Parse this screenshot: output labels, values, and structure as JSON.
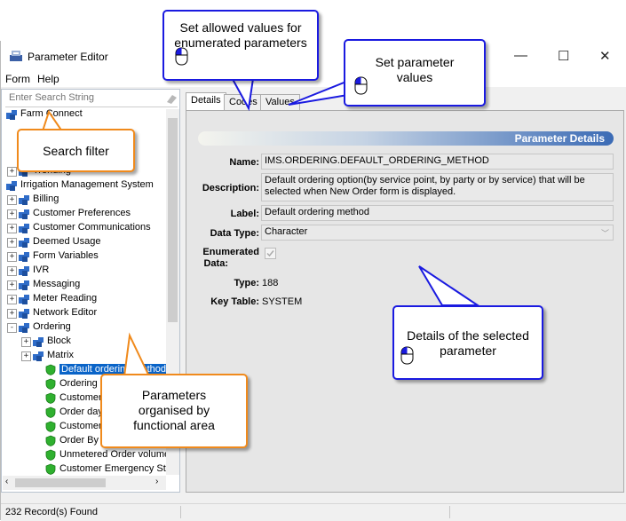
{
  "window": {
    "title": "Parameter Editor",
    "controls": {
      "minimize": "—",
      "maximize": "☐",
      "close": "✕"
    }
  },
  "menu": {
    "items": [
      "Form",
      "Help"
    ]
  },
  "search": {
    "placeholder": "Enter Search String"
  },
  "tree": {
    "root1": "Farm Connect",
    "root1_partial_child": "Trending",
    "root2": "Irrigation Management System",
    "children": [
      "Billing",
      "Customer Preferences",
      "Customer Communications",
      "Deemed Usage",
      "Form Variables",
      "IVR",
      "Messaging",
      "Meter Reading",
      "Network Editor",
      "Ordering"
    ],
    "ordering_children": [
      "Block",
      "Matrix"
    ],
    "parameters": [
      "Default ordering method",
      "Ordering b",
      "Customer N",
      "Order days",
      "Customer C",
      "Order By C",
      "Unmetered Order volume",
      "Customer Emergency Stop"
    ],
    "selected_index": 0
  },
  "tabs": [
    "Details",
    "Codes",
    "Values"
  ],
  "details": {
    "header": "Parameter Details",
    "labels": {
      "name": "Name:",
      "description": "Description:",
      "label": "Label:",
      "data_type": "Data Type:",
      "enumerated": "Enumerated",
      "enumerated2": "Data:",
      "type": "Type:",
      "key_table": "Key Table:"
    },
    "values": {
      "name": "IMS.ORDERING.DEFAULT_ORDERING_METHOD",
      "description": "Default ordering option(by service point, by party or by service) that will be selected when New Order form is displayed.",
      "label": "Default ordering method",
      "data_type": "Character",
      "enumerated": true,
      "type": "188",
      "key_table": "SYSTEM"
    }
  },
  "status": {
    "text": "232 Record(s) Found"
  },
  "callouts": {
    "codes": "Set allowed values for enumerated parameters",
    "values": "Set parameter values",
    "search": "Search filter",
    "details": "Details of the selected parameter",
    "tree": "Parameters organised by functional area"
  },
  "colors": {
    "callout_blue": "#1a1ae0",
    "callout_orange": "#f08a1c",
    "header_blue": "#3b6bb5",
    "selection": "#0a64c8"
  }
}
